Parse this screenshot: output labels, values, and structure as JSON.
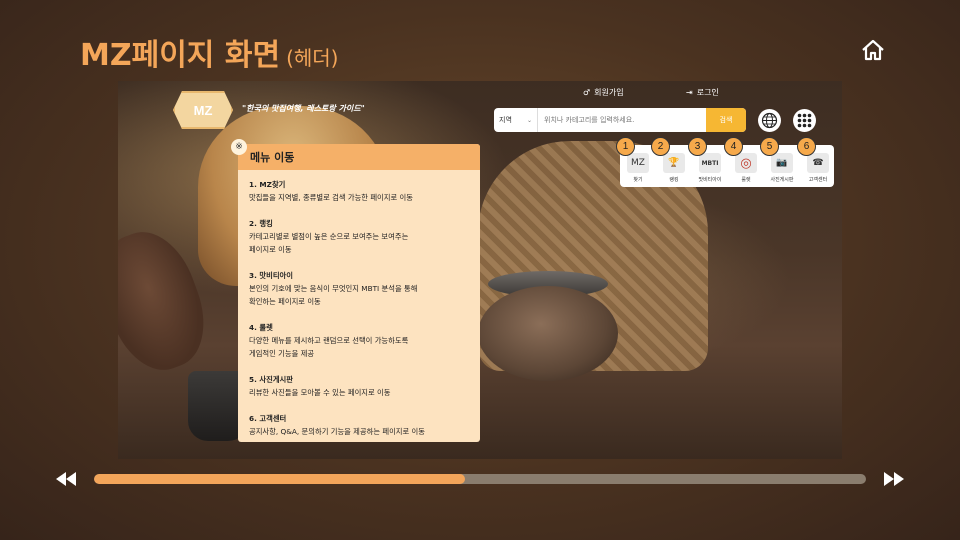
{
  "slide": {
    "title": "MZ페이지 화면",
    "subtitle": "(헤더)"
  },
  "site": {
    "logo_text": "MZ",
    "tagline": "\"한국의 맛집여행, 레스토랑 가이드\"",
    "signup_label": "회원가입",
    "login_label": "로그인",
    "search": {
      "region_value": "지역",
      "placeholder": "위치나 카테고리를 입력하세요.",
      "button_label": "검색"
    }
  },
  "menu_strip": [
    {
      "number": "1",
      "label": "찾기",
      "icon": "mz-icon",
      "glyph": "MZ"
    },
    {
      "number": "2",
      "label": "랭킹",
      "icon": "trophy-icon",
      "glyph": "🏆"
    },
    {
      "number": "3",
      "label": "맛비티아이",
      "icon": "mbti-icon",
      "glyph": "MBTI"
    },
    {
      "number": "4",
      "label": "룰렛",
      "icon": "roulette-icon",
      "glyph": "◎"
    },
    {
      "number": "5",
      "label": "사진게시판",
      "icon": "camera-icon",
      "glyph": "📷"
    },
    {
      "number": "6",
      "label": "고객센터",
      "icon": "customer-service-icon",
      "glyph": "☎"
    }
  ],
  "menu_panel": {
    "note_mark": "※",
    "header": "메뉴 이동",
    "entries": [
      {
        "title": "1. MZ찾기",
        "desc": "맛집들을 지역별, 종류별로 검색 가능한 페이지로 이동"
      },
      {
        "title": "2. 랭킹",
        "desc": "카테고리별로 별점이 높은 순으로 보여주는 보여주는\n페이지로 이동"
      },
      {
        "title": "3. 맛비티아이",
        "desc": "본인의 기호에 맞는 음식이 무엇인지 MBTI 분석을 통해\n확인하는 페이지로 이동"
      },
      {
        "title": "4. 룰렛",
        "desc": "다양한 메뉴를 제시하고 랜덤으로 선택이 가능하도록\n게임적인 기능을 제공"
      },
      {
        "title": "5. 사진게시판",
        "desc": "리뷰한 사진들을 모아볼 수 있는 페이지로 이동"
      },
      {
        "title": "6. 고객센터",
        "desc": "공지사항, Q&A, 문의하기 기능을 제공하는 페이지로 이동"
      }
    ]
  },
  "player": {
    "progress": 0.48
  },
  "colors": {
    "accent": "#f4a659",
    "search_button": "#f6b733",
    "panel_bg": "#fde3c0",
    "panel_header": "#f5b068"
  }
}
